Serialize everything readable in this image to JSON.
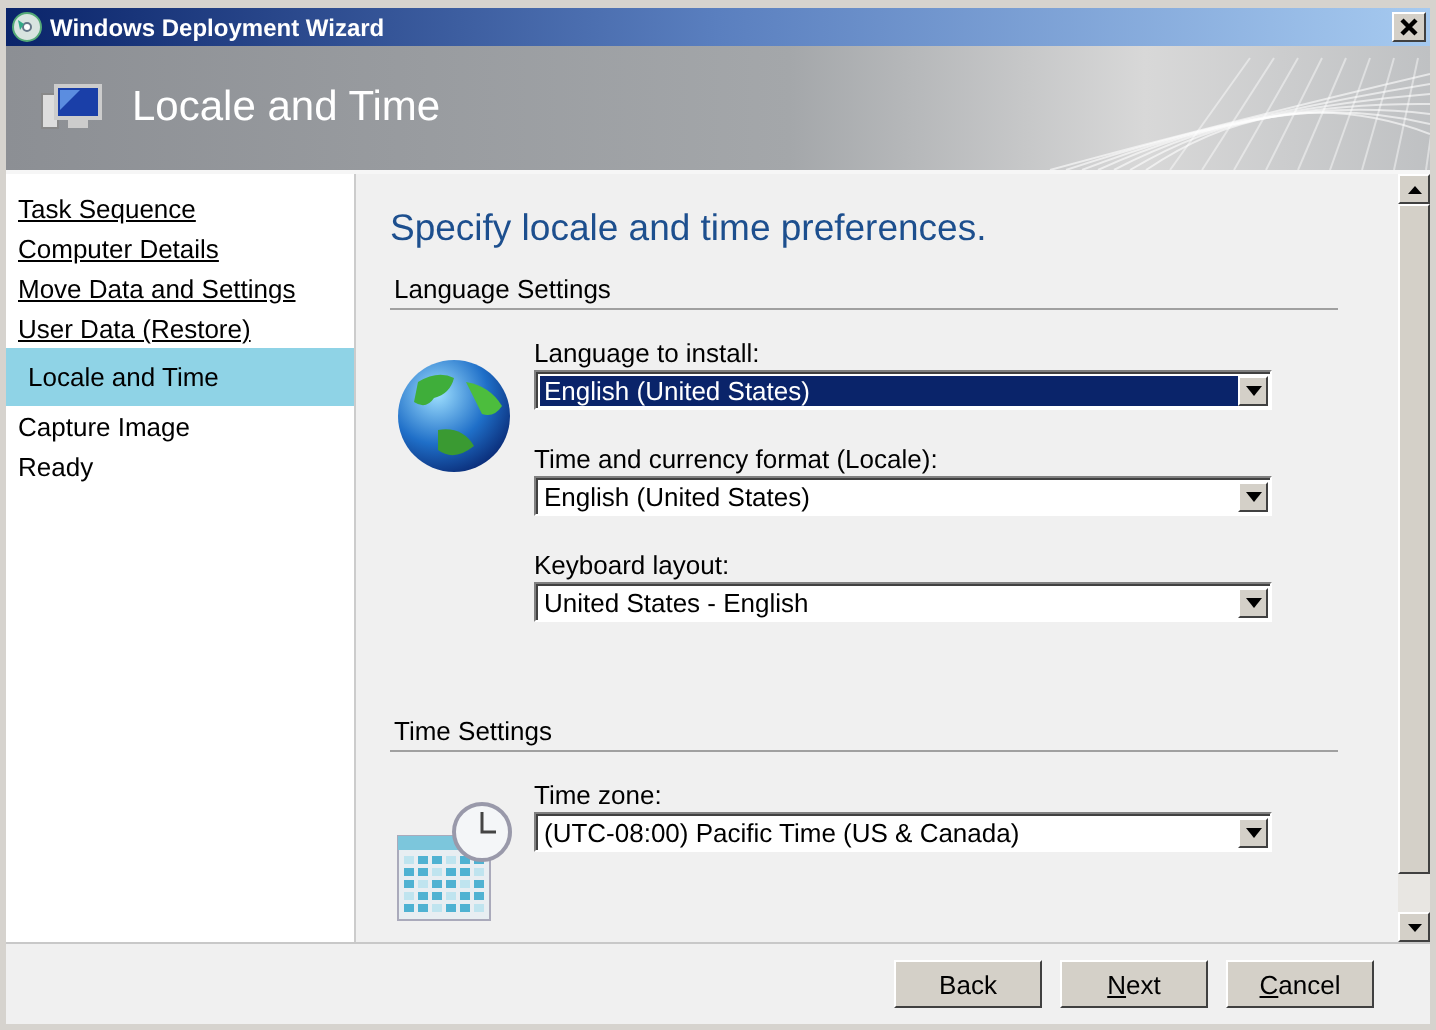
{
  "window": {
    "title": "Windows Deployment Wizard"
  },
  "header": {
    "title": "Locale and Time"
  },
  "sidebar": {
    "items": [
      {
        "label": "Task Sequence",
        "completed": true,
        "selected": false
      },
      {
        "label": "Computer Details",
        "completed": true,
        "selected": false
      },
      {
        "label": "Move Data and Settings",
        "completed": true,
        "selected": false
      },
      {
        "label": "User Data (Restore)",
        "completed": true,
        "selected": false
      },
      {
        "label": "Locale and Time",
        "completed": false,
        "selected": true
      },
      {
        "label": "Capture Image",
        "completed": false,
        "selected": false
      },
      {
        "label": "Ready",
        "completed": false,
        "selected": false
      }
    ]
  },
  "content": {
    "heading": "Specify locale and time preferences.",
    "sections": [
      {
        "title": "Language Settings",
        "kind": "globe",
        "fields": [
          {
            "label": "Language to install:",
            "value": "English (United States)",
            "focused": true
          },
          {
            "label": "Time and currency format (Locale):",
            "value": "English (United States)",
            "focused": false
          },
          {
            "label": "Keyboard layout:",
            "value": "United States - English",
            "focused": false
          }
        ]
      },
      {
        "title": "Time Settings",
        "kind": "calendar",
        "fields": [
          {
            "label": "Time zone:",
            "value": "(UTC-08:00) Pacific Time (US & Canada)",
            "focused": false
          }
        ]
      }
    ]
  },
  "buttons": [
    {
      "label": "Back",
      "access_key_first": false
    },
    {
      "label": "Next",
      "access_key_first": true
    },
    {
      "label": "Cancel",
      "access_key_first": true
    }
  ]
}
